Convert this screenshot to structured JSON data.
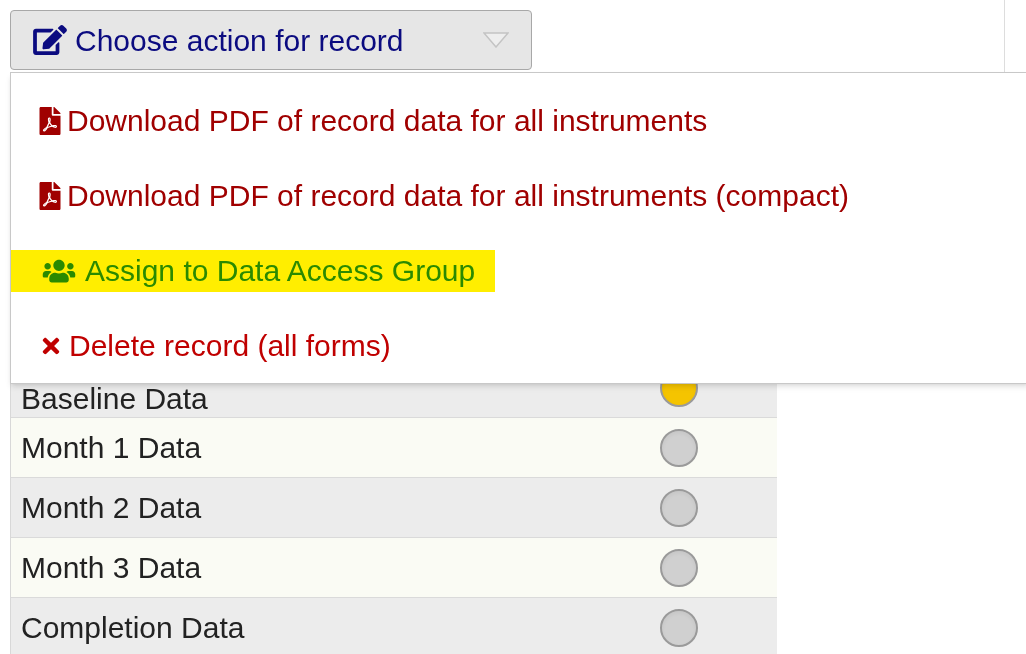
{
  "action_button": {
    "label": "Choose action for record"
  },
  "menu": {
    "items": [
      {
        "kind": "pdf",
        "label": "Download PDF of record data for all instruments",
        "highlighted": false
      },
      {
        "kind": "pdf",
        "label": "Download PDF of record data for all instruments (compact)",
        "highlighted": false
      },
      {
        "kind": "group",
        "label": "Assign to Data Access Group",
        "highlighted": true
      },
      {
        "kind": "delete",
        "label": "Delete record (all forms)",
        "highlighted": false
      }
    ]
  },
  "table": {
    "rows": [
      {
        "name": "Baseline Data",
        "color": "#f5c400"
      },
      {
        "name": "Month 1 Data",
        "color": "#d0d0d0"
      },
      {
        "name": "Month 2 Data",
        "color": "#d0d0d0"
      },
      {
        "name": "Month 3 Data",
        "color": "#d0d0d0"
      },
      {
        "name": "Completion Data",
        "color": "#d0d0d0"
      }
    ]
  }
}
